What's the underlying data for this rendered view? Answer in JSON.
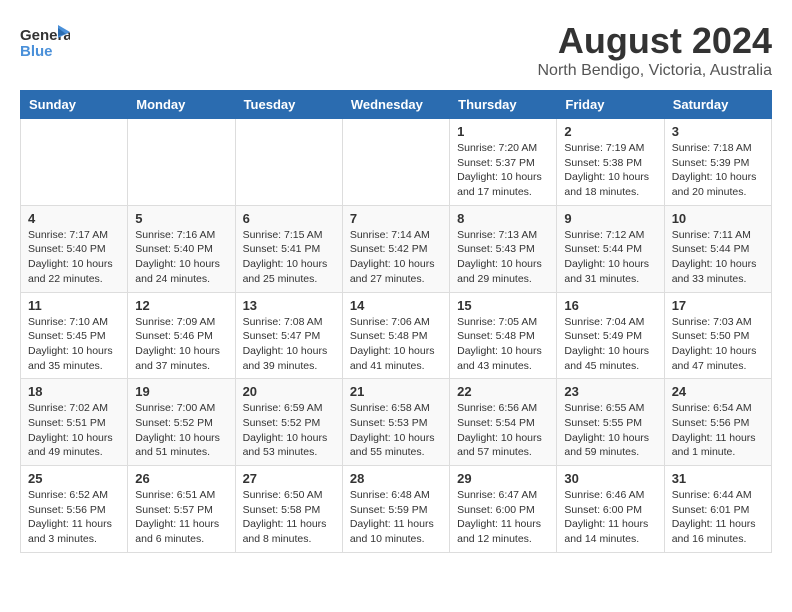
{
  "logo": {
    "text_general": "General",
    "text_blue": "Blue",
    "bird_symbol": "🐦"
  },
  "title": {
    "month_year": "August 2024",
    "location": "North Bendigo, Victoria, Australia"
  },
  "weekdays": [
    "Sunday",
    "Monday",
    "Tuesday",
    "Wednesday",
    "Thursday",
    "Friday",
    "Saturday"
  ],
  "weeks": [
    [
      {
        "day": "",
        "info": ""
      },
      {
        "day": "",
        "info": ""
      },
      {
        "day": "",
        "info": ""
      },
      {
        "day": "",
        "info": ""
      },
      {
        "day": "1",
        "info": "Sunrise: 7:20 AM\nSunset: 5:37 PM\nDaylight: 10 hours\nand 17 minutes."
      },
      {
        "day": "2",
        "info": "Sunrise: 7:19 AM\nSunset: 5:38 PM\nDaylight: 10 hours\nand 18 minutes."
      },
      {
        "day": "3",
        "info": "Sunrise: 7:18 AM\nSunset: 5:39 PM\nDaylight: 10 hours\nand 20 minutes."
      }
    ],
    [
      {
        "day": "4",
        "info": "Sunrise: 7:17 AM\nSunset: 5:40 PM\nDaylight: 10 hours\nand 22 minutes."
      },
      {
        "day": "5",
        "info": "Sunrise: 7:16 AM\nSunset: 5:40 PM\nDaylight: 10 hours\nand 24 minutes."
      },
      {
        "day": "6",
        "info": "Sunrise: 7:15 AM\nSunset: 5:41 PM\nDaylight: 10 hours\nand 25 minutes."
      },
      {
        "day": "7",
        "info": "Sunrise: 7:14 AM\nSunset: 5:42 PM\nDaylight: 10 hours\nand 27 minutes."
      },
      {
        "day": "8",
        "info": "Sunrise: 7:13 AM\nSunset: 5:43 PM\nDaylight: 10 hours\nand 29 minutes."
      },
      {
        "day": "9",
        "info": "Sunrise: 7:12 AM\nSunset: 5:44 PM\nDaylight: 10 hours\nand 31 minutes."
      },
      {
        "day": "10",
        "info": "Sunrise: 7:11 AM\nSunset: 5:44 PM\nDaylight: 10 hours\nand 33 minutes."
      }
    ],
    [
      {
        "day": "11",
        "info": "Sunrise: 7:10 AM\nSunset: 5:45 PM\nDaylight: 10 hours\nand 35 minutes."
      },
      {
        "day": "12",
        "info": "Sunrise: 7:09 AM\nSunset: 5:46 PM\nDaylight: 10 hours\nand 37 minutes."
      },
      {
        "day": "13",
        "info": "Sunrise: 7:08 AM\nSunset: 5:47 PM\nDaylight: 10 hours\nand 39 minutes."
      },
      {
        "day": "14",
        "info": "Sunrise: 7:06 AM\nSunset: 5:48 PM\nDaylight: 10 hours\nand 41 minutes."
      },
      {
        "day": "15",
        "info": "Sunrise: 7:05 AM\nSunset: 5:48 PM\nDaylight: 10 hours\nand 43 minutes."
      },
      {
        "day": "16",
        "info": "Sunrise: 7:04 AM\nSunset: 5:49 PM\nDaylight: 10 hours\nand 45 minutes."
      },
      {
        "day": "17",
        "info": "Sunrise: 7:03 AM\nSunset: 5:50 PM\nDaylight: 10 hours\nand 47 minutes."
      }
    ],
    [
      {
        "day": "18",
        "info": "Sunrise: 7:02 AM\nSunset: 5:51 PM\nDaylight: 10 hours\nand 49 minutes."
      },
      {
        "day": "19",
        "info": "Sunrise: 7:00 AM\nSunset: 5:52 PM\nDaylight: 10 hours\nand 51 minutes."
      },
      {
        "day": "20",
        "info": "Sunrise: 6:59 AM\nSunset: 5:52 PM\nDaylight: 10 hours\nand 53 minutes."
      },
      {
        "day": "21",
        "info": "Sunrise: 6:58 AM\nSunset: 5:53 PM\nDaylight: 10 hours\nand 55 minutes."
      },
      {
        "day": "22",
        "info": "Sunrise: 6:56 AM\nSunset: 5:54 PM\nDaylight: 10 hours\nand 57 minutes."
      },
      {
        "day": "23",
        "info": "Sunrise: 6:55 AM\nSunset: 5:55 PM\nDaylight: 10 hours\nand 59 minutes."
      },
      {
        "day": "24",
        "info": "Sunrise: 6:54 AM\nSunset: 5:56 PM\nDaylight: 11 hours\nand 1 minute."
      }
    ],
    [
      {
        "day": "25",
        "info": "Sunrise: 6:52 AM\nSunset: 5:56 PM\nDaylight: 11 hours\nand 3 minutes."
      },
      {
        "day": "26",
        "info": "Sunrise: 6:51 AM\nSunset: 5:57 PM\nDaylight: 11 hours\nand 6 minutes."
      },
      {
        "day": "27",
        "info": "Sunrise: 6:50 AM\nSunset: 5:58 PM\nDaylight: 11 hours\nand 8 minutes."
      },
      {
        "day": "28",
        "info": "Sunrise: 6:48 AM\nSunset: 5:59 PM\nDaylight: 11 hours\nand 10 minutes."
      },
      {
        "day": "29",
        "info": "Sunrise: 6:47 AM\nSunset: 6:00 PM\nDaylight: 11 hours\nand 12 minutes."
      },
      {
        "day": "30",
        "info": "Sunrise: 6:46 AM\nSunset: 6:00 PM\nDaylight: 11 hours\nand 14 minutes."
      },
      {
        "day": "31",
        "info": "Sunrise: 6:44 AM\nSunset: 6:01 PM\nDaylight: 11 hours\nand 16 minutes."
      }
    ]
  ]
}
